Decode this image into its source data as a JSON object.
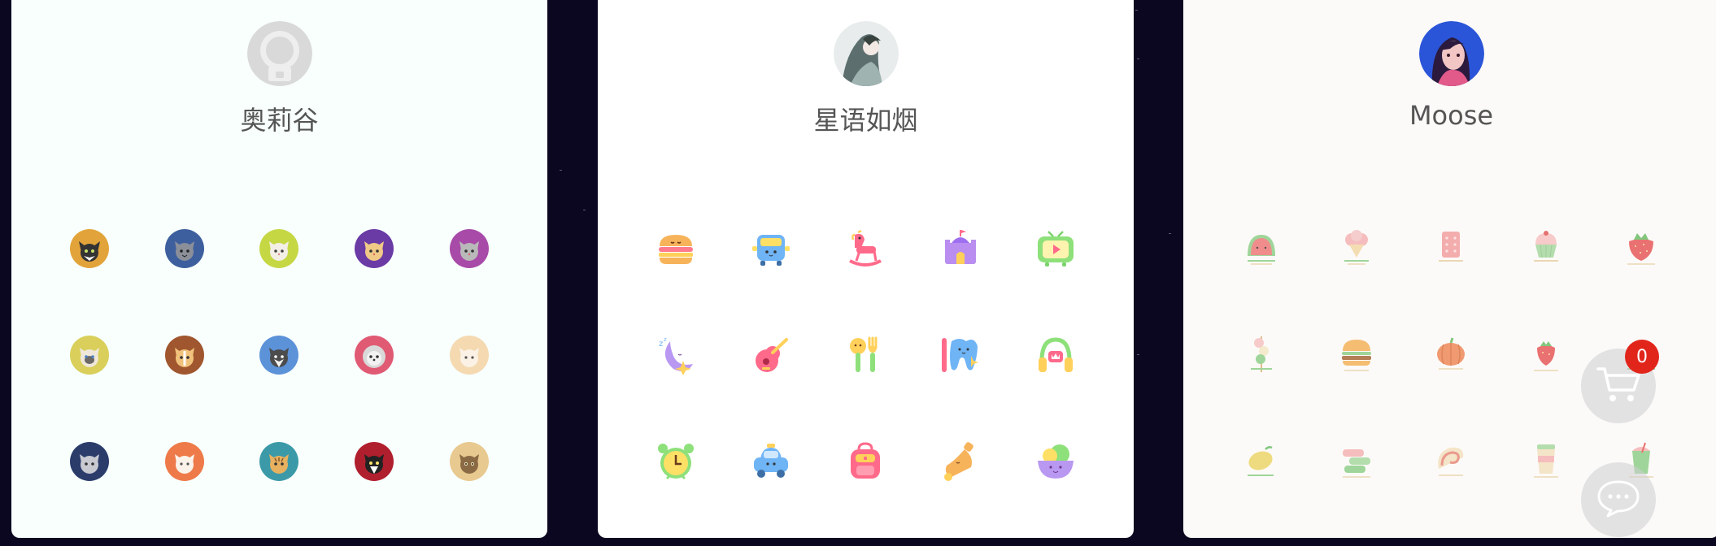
{
  "colors": {
    "background": "#0b0720",
    "badge": "#e1251b"
  },
  "cards": [
    {
      "author": "奥莉谷",
      "avatar_icon": "default-avatar-icon",
      "background": "#f8fffd",
      "icons": [
        "black-cat-icon",
        "blue-cat-icon",
        "white-cat-icon",
        "purple-cat-icon",
        "grey-cat-icon",
        "siamese-cat-icon",
        "brown-cat-icon",
        "husky-cat-icon",
        "fluffy-cat-icon",
        "cream-cat-icon",
        "navy-cat-icon",
        "orange-cat-icon",
        "tabby-cat-icon",
        "tuxedo-cat-icon",
        "striped-cat-icon"
      ]
    },
    {
      "author": "星语如烟",
      "avatar_icon": "girl-portrait-avatar",
      "background": "#ffffff",
      "icons": [
        "hamburger-icon",
        "bus-icon",
        "rocking-horse-icon",
        "castle-icon",
        "tv-icon",
        "moon-sleep-icon",
        "guitar-icon",
        "spoon-fork-icon",
        "tooth-icon",
        "headphones-icon",
        "alarm-clock-icon",
        "car-icon",
        "backpack-icon",
        "bell-icon",
        "bowl-icon"
      ]
    },
    {
      "author": "Moose",
      "avatar_icon": "girl-anime-avatar",
      "background": "#fcfaf8",
      "icons": [
        "watermelon-icon",
        "ice-cream-icon",
        "biscuit-icon",
        "cupcake-icon",
        "strawberry-icon",
        "skewer-icon",
        "burger-icon",
        "pumpkin-icon",
        "strawberry-small-icon",
        "sushi-icon",
        "lemon-icon",
        "macaron-icon",
        "spiral-cake-icon",
        "coffee-cup-icon",
        "drink-cup-icon"
      ]
    }
  ],
  "cart": {
    "count": "0",
    "icon": "cart-icon"
  },
  "chat": {
    "icon": "chat-icon"
  }
}
